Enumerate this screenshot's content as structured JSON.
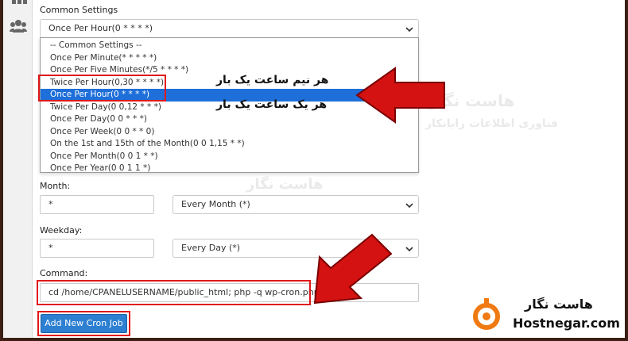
{
  "section": {
    "common_settings_label": "Common Settings",
    "common_settings_value": "Once Per Hour(0 * * * *)"
  },
  "dropdown_options": [
    "-- Common Settings --",
    "Once Per Minute(* * * * *)",
    "Once Per Five Minutes(*/5 * * * *)",
    "Twice Per Hour(0,30 * * * *)",
    "Once Per Hour(0 * * * *)",
    "Twice Per Day(0 0,12 * * *)",
    "Once Per Day(0 0 * * *)",
    "Once Per Week(0 0 * * 0)",
    "On the 1st and 15th of the Month(0 0 1,15 * *)",
    "Once Per Month(0 0 1 * *)",
    "Once Per Year(0 0 1 1 *)"
  ],
  "selected_option_index": 4,
  "month": {
    "label": "Month:",
    "input_value": "*",
    "select_value": "Every Month (*)"
  },
  "weekday": {
    "label": "Weekday:",
    "input_value": "*",
    "select_value": "Every Day (*)"
  },
  "command": {
    "label": "Command:",
    "value": "cd /home/CPANELUSERNAME/public_html; php -q wp-cron.php"
  },
  "add_button_label": "Add New Cron Job",
  "annotations": {
    "half_hour": "هر نیم ساعت یک بار",
    "one_hour": "هر یک ساعت یک بار"
  },
  "watermark": {
    "title": "هاست نگار",
    "subtitle": "فناوری اطلاعات رایانکار"
  },
  "brand": {
    "name_fa": "هاست نگار",
    "name_en": "Hostnegar.com"
  },
  "colors": {
    "highlight": "#1e6fd9",
    "annotation_red": "#e01818",
    "button": "#2d7fd1",
    "brand_orange": "#f07a12"
  }
}
